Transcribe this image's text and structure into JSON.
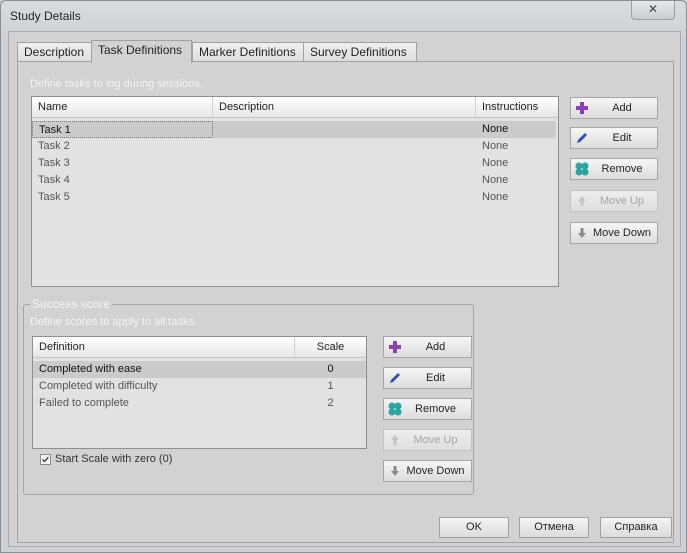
{
  "window": {
    "title": "Study Details",
    "close_glyph": "✕"
  },
  "tabs": [
    {
      "label": "Description"
    },
    {
      "label": "Task Definitions"
    },
    {
      "label": "Marker Definitions"
    },
    {
      "label": "Survey Definitions"
    }
  ],
  "tasks": {
    "hint": "Define tasks to log during sessions.",
    "columns": {
      "name": "Name",
      "description": "Description",
      "instructions": "Instructions"
    },
    "rows": [
      {
        "name": "Task 1",
        "description": "",
        "instructions": "None"
      },
      {
        "name": "Task 2",
        "description": "",
        "instructions": "None"
      },
      {
        "name": "Task 3",
        "description": "",
        "instructions": "None"
      },
      {
        "name": "Task 4",
        "description": "",
        "instructions": "None"
      },
      {
        "name": "Task 5",
        "description": "",
        "instructions": "None"
      }
    ],
    "buttons": {
      "add": "Add",
      "edit": "Edit",
      "remove": "Remove",
      "move_up": "Move Up",
      "move_down": "Move Down"
    }
  },
  "success": {
    "title": "Success score",
    "hint": "Define scores to apply to all tasks.",
    "columns": {
      "definition": "Definition",
      "scale": "Scale"
    },
    "rows": [
      {
        "definition": "Completed with ease",
        "scale": "0"
      },
      {
        "definition": "Completed with difficulty",
        "scale": "1"
      },
      {
        "definition": "Failed to complete",
        "scale": "2"
      }
    ],
    "buttons": {
      "add": "Add",
      "edit": "Edit",
      "remove": "Remove",
      "move_up": "Move Up",
      "move_down": "Move Down"
    },
    "checkbox": {
      "label": "Start Scale with zero (0)",
      "checked": true
    }
  },
  "dialog_buttons": {
    "ok": "OK",
    "cancel": "Отмена",
    "help": "Справка"
  },
  "colors": {
    "add_icon": "#8a3fb4",
    "edit_icon": "#2f4fa8",
    "remove_icon": "#2aa6a0"
  }
}
